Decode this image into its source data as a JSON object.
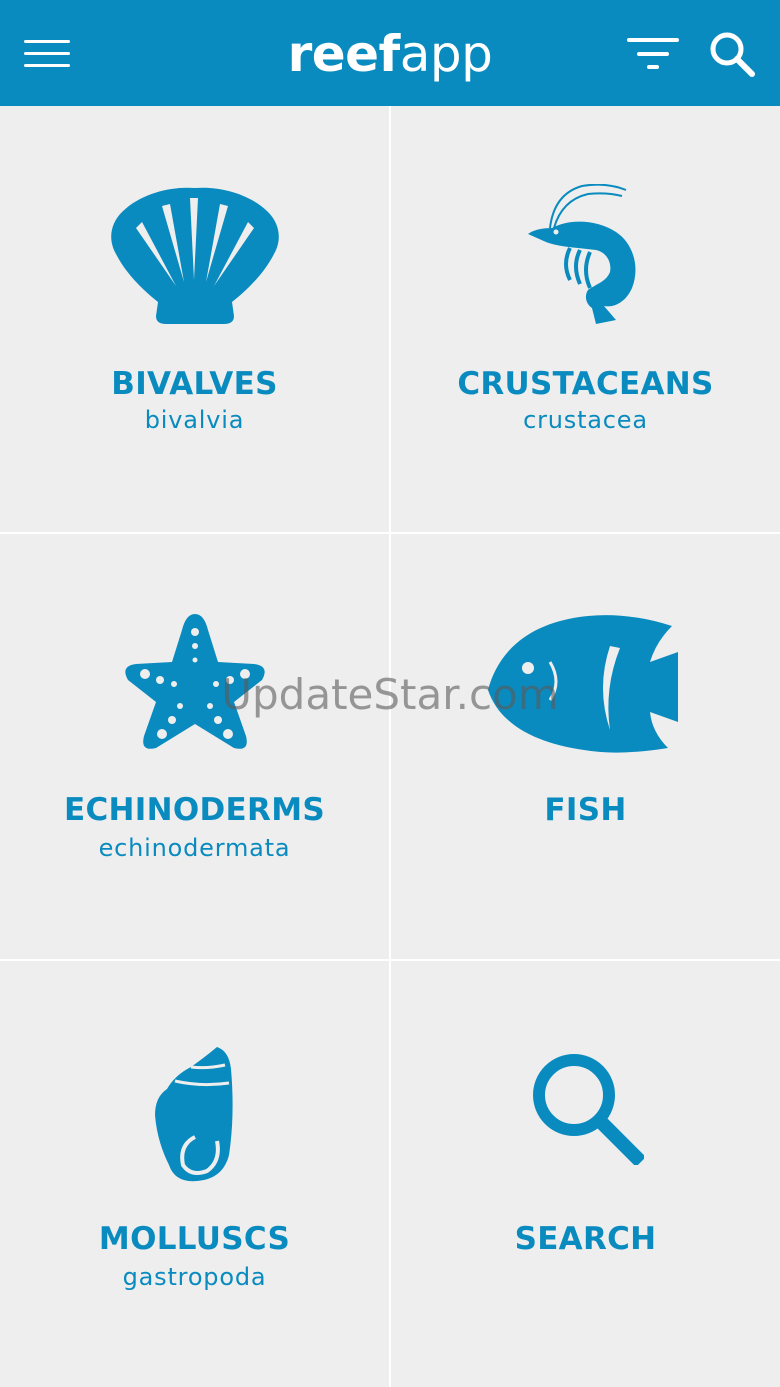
{
  "header": {
    "logo_bold": "reef",
    "logo_light": "app"
  },
  "tiles": [
    {
      "title": "BIVALVES",
      "subtitle": "bivalvia",
      "icon": "scallop-shell-icon"
    },
    {
      "title": "CRUSTACEANS",
      "subtitle": "crustacea",
      "icon": "shrimp-icon"
    },
    {
      "title": "ECHINODERMS",
      "subtitle": "echinodermata",
      "icon": "starfish-icon"
    },
    {
      "title": "FISH",
      "subtitle": "",
      "icon": "angelfish-icon"
    },
    {
      "title": "MOLLUSCS",
      "subtitle": "gastropoda",
      "icon": "snail-shell-icon"
    },
    {
      "title": "SEARCH",
      "subtitle": "",
      "icon": "magnifier-icon"
    }
  ],
  "watermark": "UpdateStar.com",
  "colors": {
    "brand": "#0a8bbf",
    "background": "#eeeeee"
  }
}
